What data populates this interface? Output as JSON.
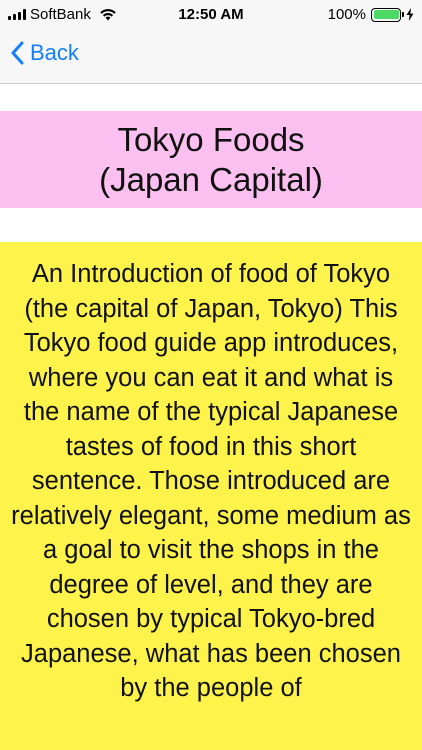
{
  "status_bar": {
    "carrier": "SoftBank",
    "time": "12:50 AM",
    "battery_percent": "100%",
    "battery_level": 1.0,
    "icons": [
      "signal-icon",
      "wifi-icon",
      "battery-icon",
      "charging-bolt-icon"
    ]
  },
  "nav": {
    "back_label": "Back",
    "back_icon": "chevron-left-icon",
    "accent_color": "#157efb"
  },
  "title": {
    "text": "Tokyo Foods\n(Japan Capital)",
    "background": "#fbc0f0"
  },
  "body": {
    "text": "An Introduction of food of Tokyo  (the capital of Japan, Tokyo) This Tokyo food guide app introduces, where you can eat it and what is the name of the typical Japanese tastes of food in this short sentence. Those introduced are  relatively elegant, some medium as a goal to visit the shops in the degree of level, and they are chosen by typical Tokyo-bred Japanese, what has been chosen by the people of",
    "background": "#fdf34a"
  }
}
